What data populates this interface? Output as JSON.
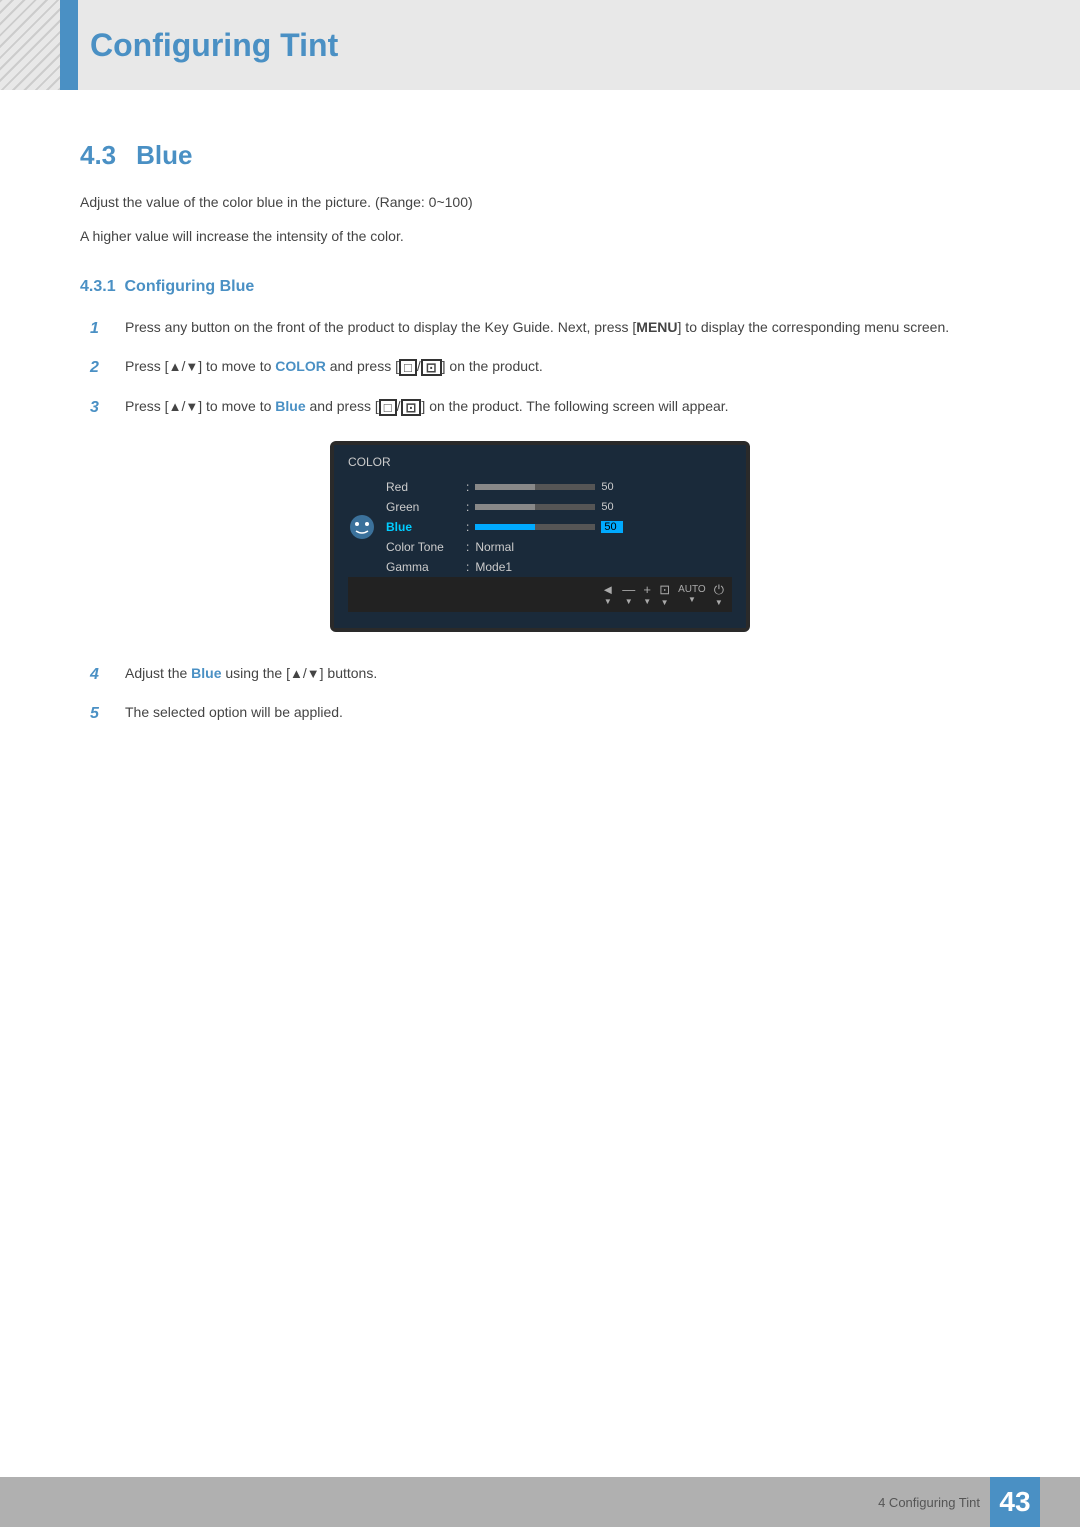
{
  "page": {
    "title": "Configuring Tint",
    "footer_section": "4 Configuring Tint",
    "footer_page": "43"
  },
  "section": {
    "number": "4.3",
    "title": "Blue",
    "description1": "Adjust the value of the color blue in the picture. (Range: 0~100)",
    "description2": "A higher value will increase the intensity of the color.",
    "subsection_number": "4.3.1",
    "subsection_title": "Configuring Blue"
  },
  "steps": [
    {
      "number": "1",
      "text": "Press any button on the front of the product to display the Key Guide. Next, press [MENU] to display the corresponding menu screen."
    },
    {
      "number": "2",
      "text_before": "Press [▲/▼] to move to ",
      "highlight": "COLOR",
      "text_after": " and press [□/⊡] on the product."
    },
    {
      "number": "3",
      "text_before": "Press [▲/▼] to move to ",
      "highlight": "Blue",
      "text_after": " and press [□/⊡] on the product. The following screen will appear."
    },
    {
      "number": "4",
      "text_before": "Adjust the ",
      "highlight": "Blue",
      "text_after": " using the [▲/▼] buttons."
    },
    {
      "number": "5",
      "text": "The selected option will be applied."
    }
  ],
  "monitor_menu": {
    "title": "COLOR",
    "rows": [
      {
        "label": "Red",
        "type": "bar",
        "value": 50,
        "max": 100,
        "active": false
      },
      {
        "label": "Green",
        "type": "bar",
        "value": 50,
        "max": 100,
        "active": false
      },
      {
        "label": "Blue",
        "type": "bar",
        "value": 50,
        "max": 100,
        "active": true
      },
      {
        "label": "Color Tone",
        "type": "text",
        "value": "Normal",
        "active": false
      },
      {
        "label": "Gamma",
        "type": "text",
        "value": "Mode1",
        "active": false
      }
    ],
    "bottom_buttons": [
      "◄",
      "—",
      "+",
      "⊡",
      "AUTO",
      "⏻"
    ]
  }
}
